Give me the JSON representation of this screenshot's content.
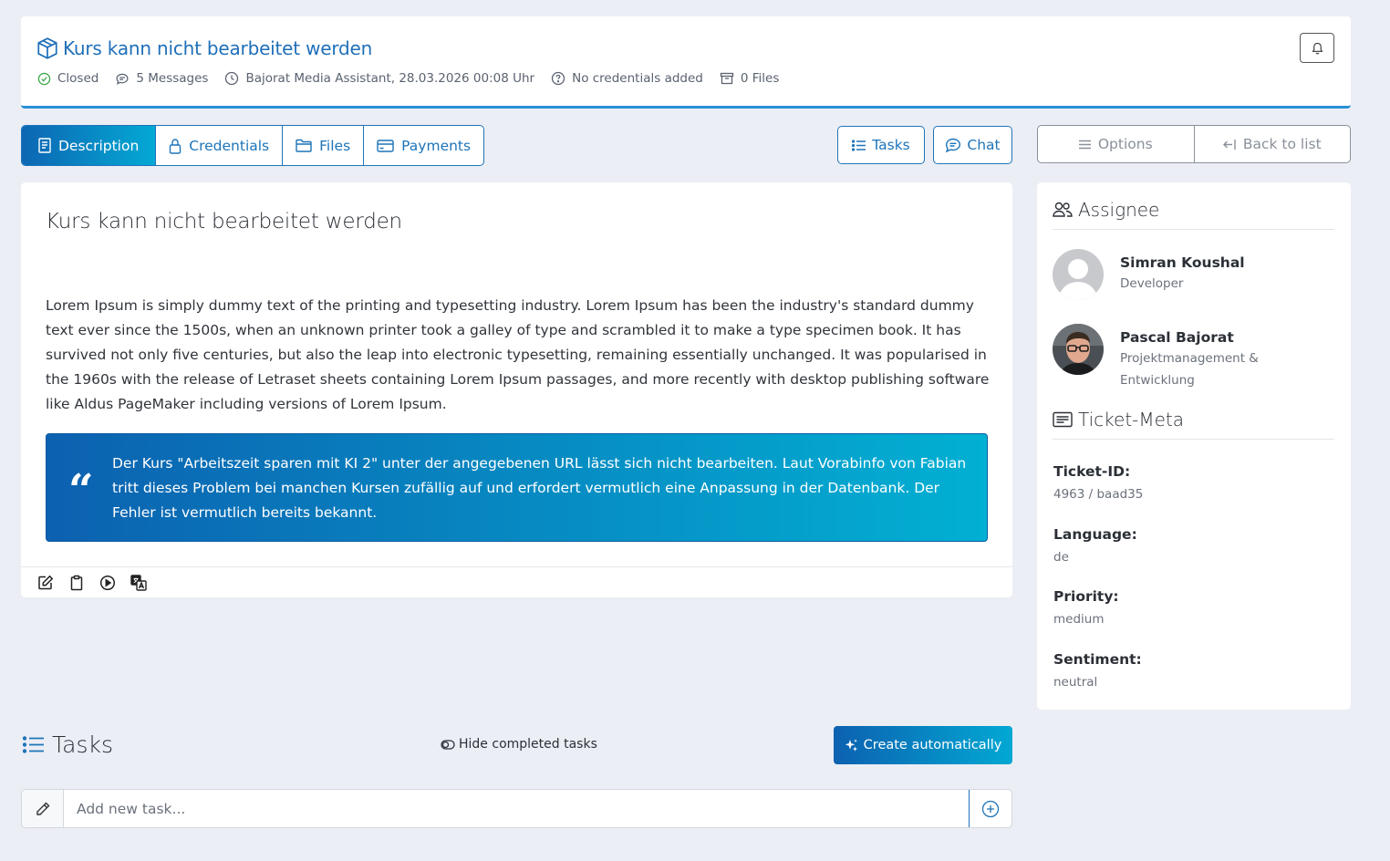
{
  "header": {
    "title": "Kurs kann nicht bearbeitet werden",
    "status": "Closed",
    "messages": "5 Messages",
    "author_time": "Bajorat Media Assistant, 28.03.2026 00:08 Uhr",
    "credentials": "No credentials added",
    "files": "0 Files"
  },
  "tabs": [
    {
      "label": "Description",
      "icon": "document-icon",
      "active": true
    },
    {
      "label": "Credentials",
      "icon": "lock-icon",
      "active": false
    },
    {
      "label": "Files",
      "icon": "folder-icon",
      "active": false
    },
    {
      "label": "Payments",
      "icon": "credit-card-icon",
      "active": false
    }
  ],
  "actions": {
    "tasks_label": "Tasks",
    "chat_label": "Chat",
    "options_label": "Options",
    "back_label": "Back to list"
  },
  "description": {
    "title": "Kurs kann nicht bearbeitet werden",
    "body": "Lorem Ipsum is simply dummy text of the printing and typesetting industry. Lorem Ipsum has been the industry's standard dummy text ever since the 1500s, when an unknown printer took a galley of type and scrambled it to make a type specimen book. It has survived not only five centuries, but also the leap into electronic typesetting, remaining essentially unchanged. It was popularised in the 1960s with the release of Letraset sheets containing Lorem Ipsum passages, and more recently with desktop publishing software like Aldus PageMaker including versions of Lorem Ipsum.",
    "quote": "Der Kurs \"Arbeitszeit sparen mit KI 2\" unter der angegebenen URL lässt sich nicht bearbeiten. Laut Vorabinfo von Fabian tritt dieses Problem bei manchen Kursen zufällig auf und erfordert vermutlich eine Anpassung in der Datenbank. Der Fehler ist vermutlich bereits bekannt."
  },
  "sidebar": {
    "assignee_title": "Assignee",
    "assignees": [
      {
        "name": "Simran Koushal",
        "role": "Developer"
      },
      {
        "name": "Pascal Bajorat",
        "role": "Projektmanagement & Entwicklung"
      }
    ],
    "meta_title": "Ticket-Meta",
    "meta": [
      {
        "key": "Ticket-ID:",
        "value": "4963 / baad35"
      },
      {
        "key": "Language:",
        "value": "de"
      },
      {
        "key": "Priority:",
        "value": "medium"
      },
      {
        "key": "Sentiment:",
        "value": "neutral"
      }
    ]
  },
  "tasks": {
    "title": "Tasks",
    "hide_completed": "Hide completed tasks",
    "create_auto": "Create automatically",
    "input_placeholder": "Add new task..."
  },
  "colors": {
    "accent": "#1d74b9",
    "gradient_start": "#0c61b0",
    "gradient_end": "#02b0d3",
    "background": "#eceef5"
  }
}
